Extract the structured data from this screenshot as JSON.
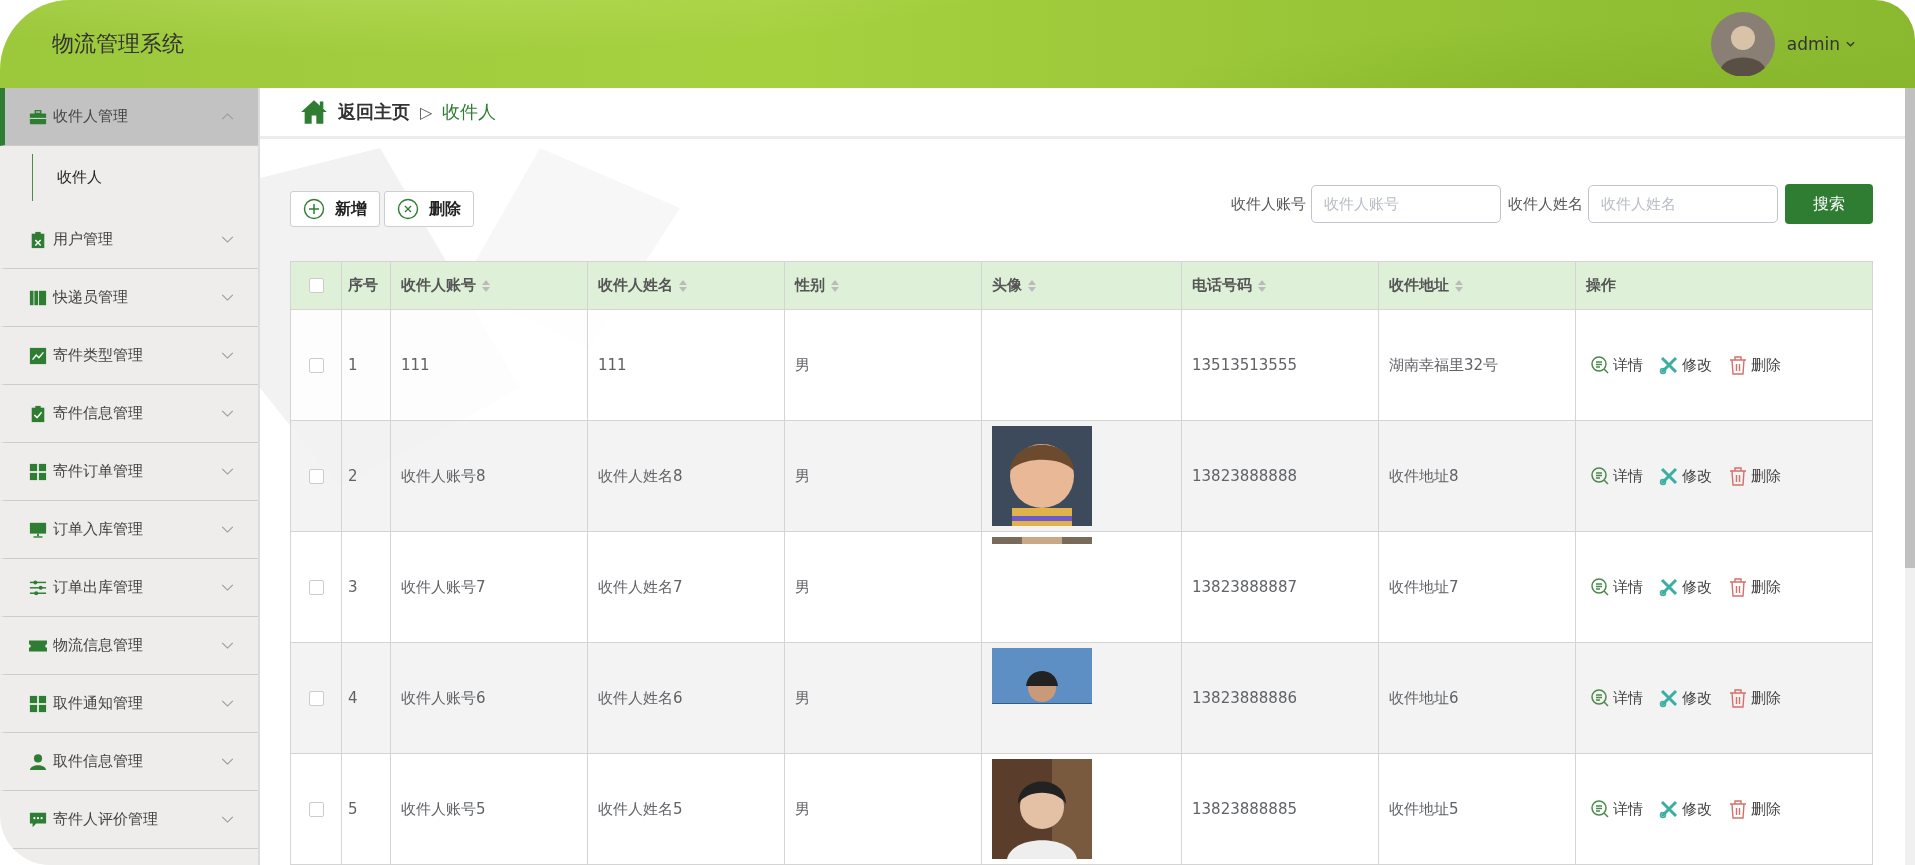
{
  "header": {
    "title": "物流管理系统",
    "user": {
      "name": "admin"
    }
  },
  "sidebar": {
    "items": [
      {
        "label": "收件人管理",
        "expanded": true,
        "selected": true,
        "children": [
          {
            "label": "收件人"
          }
        ]
      },
      {
        "label": "用户管理",
        "expanded": false,
        "selected": false
      },
      {
        "label": "快递员管理",
        "expanded": false,
        "selected": false
      },
      {
        "label": "寄件类型管理",
        "expanded": false,
        "selected": false
      },
      {
        "label": "寄件信息管理",
        "expanded": false,
        "selected": false
      },
      {
        "label": "寄件订单管理",
        "expanded": false,
        "selected": false
      },
      {
        "label": "订单入库管理",
        "expanded": false,
        "selected": false
      },
      {
        "label": "订单出库管理",
        "expanded": false,
        "selected": false
      },
      {
        "label": "物流信息管理",
        "expanded": false,
        "selected": false
      },
      {
        "label": "取件通知管理",
        "expanded": false,
        "selected": false
      },
      {
        "label": "取件信息管理",
        "expanded": false,
        "selected": false
      },
      {
        "label": "寄件人评价管理",
        "expanded": false,
        "selected": false
      }
    ]
  },
  "breadcrumb": {
    "home": "返回主页",
    "separator": "▷",
    "current": "收件人"
  },
  "toolbar": {
    "buttons": [
      {
        "kind": "add",
        "label": "新增"
      },
      {
        "kind": "delete",
        "label": "删除"
      }
    ],
    "filters": [
      {
        "label": "收件人账号",
        "placeholder": "收件人账号"
      },
      {
        "label": "收件人姓名",
        "placeholder": "收件人姓名"
      }
    ],
    "search_button": "搜索"
  },
  "table": {
    "select_all_checked": false,
    "columns": [
      {
        "label": "序号",
        "sortable": false
      },
      {
        "label": "收件人账号",
        "sortable": true
      },
      {
        "label": "收件人姓名",
        "sortable": true
      },
      {
        "label": "性别",
        "sortable": true
      },
      {
        "label": "头像",
        "sortable": true
      },
      {
        "label": "电话号码",
        "sortable": true
      },
      {
        "label": "收件地址",
        "sortable": true
      },
      {
        "label": "操作",
        "sortable": false
      }
    ],
    "rows": [
      {
        "checked": false,
        "index": "1",
        "account": "111",
        "name": "111",
        "gender": "男",
        "phone": "13513513555",
        "address": "湖南幸福里32号",
        "actions": [
          {
            "kind": "detail",
            "label": "详情"
          },
          {
            "kind": "edit",
            "label": "修改"
          },
          {
            "kind": "delete",
            "label": "删除"
          }
        ]
      },
      {
        "checked": false,
        "index": "2",
        "account": "收件人账号8",
        "name": "收件人姓名8",
        "gender": "男",
        "phone": "13823888888",
        "address": "收件地址8",
        "actions": [
          {
            "kind": "detail",
            "label": "详情"
          },
          {
            "kind": "edit",
            "label": "修改"
          },
          {
            "kind": "delete",
            "label": "删除"
          }
        ]
      },
      {
        "checked": false,
        "index": "3",
        "account": "收件人账号7",
        "name": "收件人姓名7",
        "gender": "男",
        "phone": "13823888887",
        "address": "收件地址7",
        "actions": [
          {
            "kind": "detail",
            "label": "详情"
          },
          {
            "kind": "edit",
            "label": "修改"
          },
          {
            "kind": "delete",
            "label": "删除"
          }
        ]
      },
      {
        "checked": false,
        "index": "4",
        "account": "收件人账号6",
        "name": "收件人姓名6",
        "gender": "男",
        "phone": "13823888886",
        "address": "收件地址6",
        "actions": [
          {
            "kind": "detail",
            "label": "详情"
          },
          {
            "kind": "edit",
            "label": "修改"
          },
          {
            "kind": "delete",
            "label": "删除"
          }
        ]
      },
      {
        "checked": false,
        "index": "5",
        "account": "收件人账号5",
        "name": "收件人姓名5",
        "gender": "男",
        "phone": "13823888885",
        "address": "收件地址5",
        "actions": [
          {
            "kind": "detail",
            "label": "详情"
          },
          {
            "kind": "edit",
            "label": "修改"
          },
          {
            "kind": "delete",
            "label": "删除"
          }
        ]
      }
    ]
  }
}
